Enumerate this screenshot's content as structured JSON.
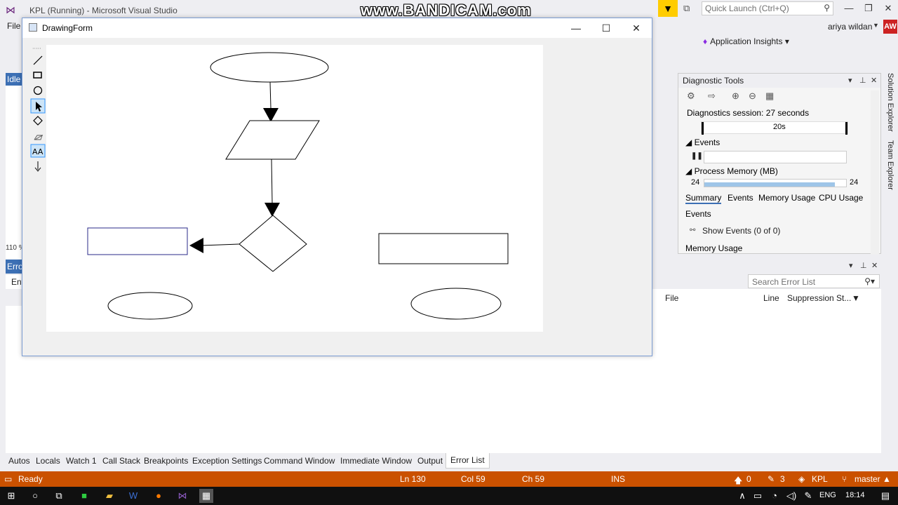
{
  "vs": {
    "title": "KPL (Running) - Microsoft Visual Studio",
    "menu_file": "File",
    "quick_launch_placeholder": "Quick Launch (Ctrl+Q)",
    "user_name": "ariya wildan",
    "avatar_initials": "AW",
    "app_insights": "Application Insights",
    "left_stub_tab1": "Idle",
    "left_stub_tab2": "Erro",
    "left_stub_entire": "Ent",
    "zoom": "110 %"
  },
  "watermark": "www.BANDICAM.com",
  "form": {
    "title": "DrawingForm",
    "tools": [
      "line-icon",
      "rectangle-icon",
      "ellipse-icon",
      "pointer-icon",
      "diamond-icon",
      "parallelogram-icon",
      "text-icon",
      "arrow-icon"
    ]
  },
  "diagnostic_tools": {
    "title": "Diagnostic Tools",
    "session": "Diagnostics session: 27 seconds",
    "timeline_label": "20s",
    "events_label": "Events",
    "process_memory_label": "Process Memory (MB)",
    "mem_min": "24",
    "mem_max": "24",
    "tabs": [
      "Summary",
      "Events",
      "Memory Usage",
      "CPU Usage"
    ],
    "events_section": "Events",
    "show_events": "Show Events (0 of 0)",
    "memory_usage_section": "Memory Usage"
  },
  "side_tabs": [
    "Solution Explorer",
    "Team Explorer"
  ],
  "error_list": {
    "search_placeholder": "Search Error List",
    "columns": [
      "File",
      "Line",
      "Suppression St..."
    ]
  },
  "bottom_tabs": [
    "Autos",
    "Locals",
    "Watch 1",
    "Call Stack",
    "Breakpoints",
    "Exception Settings",
    "Command Window",
    "Immediate Window",
    "Output",
    "Error List"
  ],
  "status": {
    "ready": "Ready",
    "ln": "Ln 130",
    "col": "Col 59",
    "ch": "Ch 59",
    "ins": "INS",
    "up_count": "0",
    "edit_count": "3",
    "repo": "KPL",
    "branch": "master"
  },
  "taskbar": {
    "lang": "ENG",
    "time": "18:14"
  },
  "colors": {
    "status_bar": "#ca5100",
    "accent": "#3c6fb4"
  }
}
